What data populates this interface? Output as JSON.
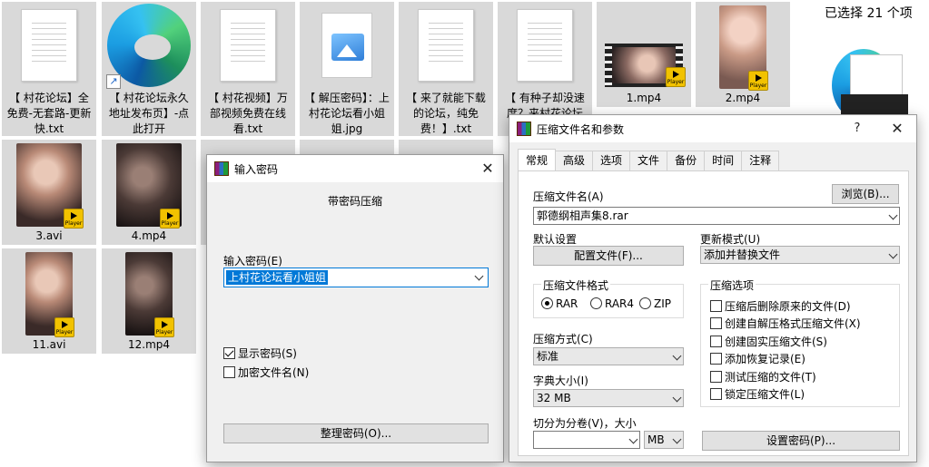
{
  "explorer": {
    "selected_count": "已选择 21 个项",
    "files": [
      {
        "name": "【 村花论坛】全免费-无套路-更新快.txt",
        "kind": "txt"
      },
      {
        "name": "【 村花论坛永久地址发布页】-点此打开",
        "kind": "edge"
      },
      {
        "name": "【 村花视频】万部视频免费在线看.txt",
        "kind": "txt"
      },
      {
        "name": "【 解压密码】：上村花论坛看小姐姐.jpg",
        "kind": "jpg"
      },
      {
        "name": "【 来了就能下载的论坛，纯免费！】.txt",
        "kind": "txt"
      },
      {
        "name": "【 有种子却没速度？来村花论坛",
        "kind": "txt"
      },
      {
        "name": "1.mp4",
        "kind": "video"
      },
      {
        "name": "2.mp4",
        "kind": "video"
      },
      {
        "name": "3.avi",
        "kind": "video"
      },
      {
        "name": "4.mp4",
        "kind": "video"
      },
      {
        "name": "11.avi",
        "kind": "video"
      },
      {
        "name": "12.mp4",
        "kind": "video"
      }
    ],
    "player_badge": "Player"
  },
  "password_dialog": {
    "title": "输入密码",
    "close": "✕",
    "subtitle": "带密码压缩",
    "input_label": "输入密码(E)",
    "input_value": "上村花论坛看小姐姐",
    "show_password": "显示密码(S)",
    "show_password_checked": true,
    "encrypt_names": "加密文件名(N)",
    "encrypt_names_checked": false,
    "organize_button": "整理密码(O)..."
  },
  "archive_dialog": {
    "title": "压缩文件名和参数",
    "help": "?",
    "close": "✕",
    "tabs": [
      "常规",
      "高级",
      "选项",
      "文件",
      "备份",
      "时间",
      "注释"
    ],
    "active_tab": 0,
    "archive_name_label": "压缩文件名(A)",
    "browse_button": "浏览(B)...",
    "archive_name_value": "郭德纲相声集8.rar",
    "default_settings_label": "默认设置",
    "profile_button": "配置文件(F)...",
    "update_mode_label": "更新模式(U)",
    "update_mode_value": "添加并替换文件",
    "format_group": "压缩文件格式",
    "formats": [
      "RAR",
      "RAR4",
      "ZIP"
    ],
    "selected_format": 0,
    "options_group": "压缩选项",
    "options": [
      "压缩后删除原来的文件(D)",
      "创建自解压格式压缩文件(X)",
      "创建固实压缩文件(S)",
      "添加恢复记录(E)",
      "测试压缩的文件(T)",
      "锁定压缩文件(L)"
    ],
    "method_label": "压缩方式(C)",
    "method_value": "标准",
    "dict_label": "字典大小(I)",
    "dict_value": "32 MB",
    "split_label": "切分为分卷(V)，大小",
    "split_value": "",
    "split_unit": "MB",
    "set_password_button": "设置密码(P)..."
  }
}
